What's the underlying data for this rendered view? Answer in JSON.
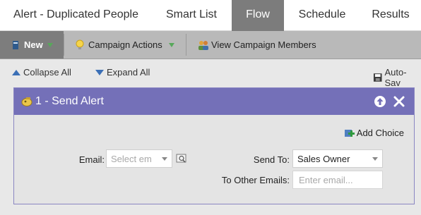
{
  "header": {
    "title": "Alert - Duplicated People",
    "tabs": [
      {
        "label": "Smart List",
        "active": false
      },
      {
        "label": "Flow",
        "active": true
      },
      {
        "label": "Schedule",
        "active": false
      },
      {
        "label": "Results",
        "active": false
      }
    ]
  },
  "toolbar": {
    "new_label": "New",
    "campaign_actions_label": "Campaign Actions",
    "view_members_label": "View Campaign Members"
  },
  "subbar": {
    "collapse_label": "Collapse All",
    "expand_label": "Expand All",
    "autosave_label": "Auto-Sav"
  },
  "flow_step": {
    "title": "1 - Send Alert",
    "add_choice_label": "Add Choice",
    "email_label": "Email:",
    "email_placeholder": "Select em",
    "send_to_label": "Send To:",
    "send_to_value": "Sales Owner",
    "other_emails_label": "To Other Emails:",
    "other_emails_placeholder": "Enter email..."
  },
  "colors": {
    "panel_header": "#7470b8",
    "active_tab": "#7c7c7c",
    "toolbar": "#b9b9b9",
    "accent_blue": "#3b6fb6"
  }
}
